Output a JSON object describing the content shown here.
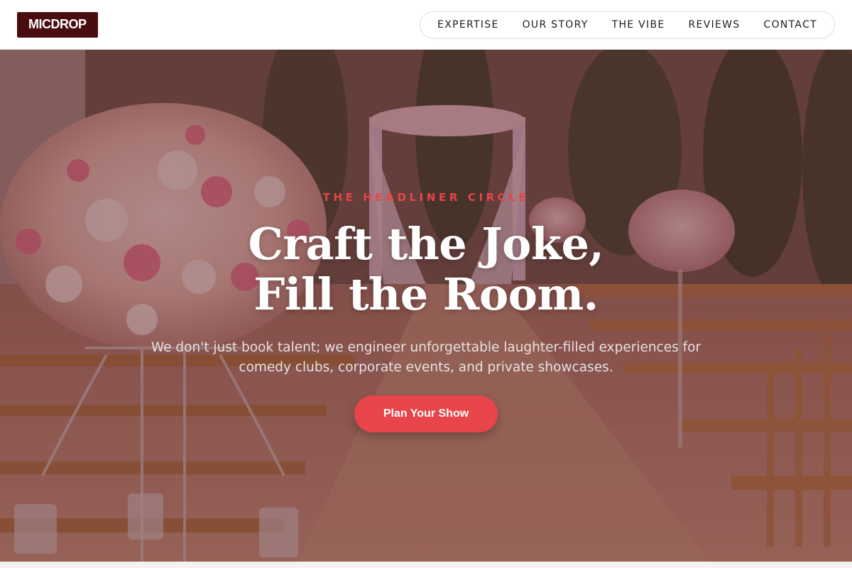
{
  "header": {
    "logo": "MICDROP",
    "nav": [
      "EXPERTISE",
      "OUR STORY",
      "THE VIBE",
      "REVIEWS",
      "CONTACT"
    ]
  },
  "hero": {
    "eyebrow": "THE HEADLINER CIRCLE",
    "headline_line1": "Craft the Joke,",
    "headline_line2": "Fill the Room.",
    "subtext": "We don't just book talent; we engineer unforgettable laughter-filled experiences for comedy clubs, corporate events, and private showcases.",
    "cta": "Plan Your Show"
  },
  "colors": {
    "logo_bg": "#4a0d0f",
    "accent": "#e8454a",
    "overlay": "#5c1c22"
  }
}
